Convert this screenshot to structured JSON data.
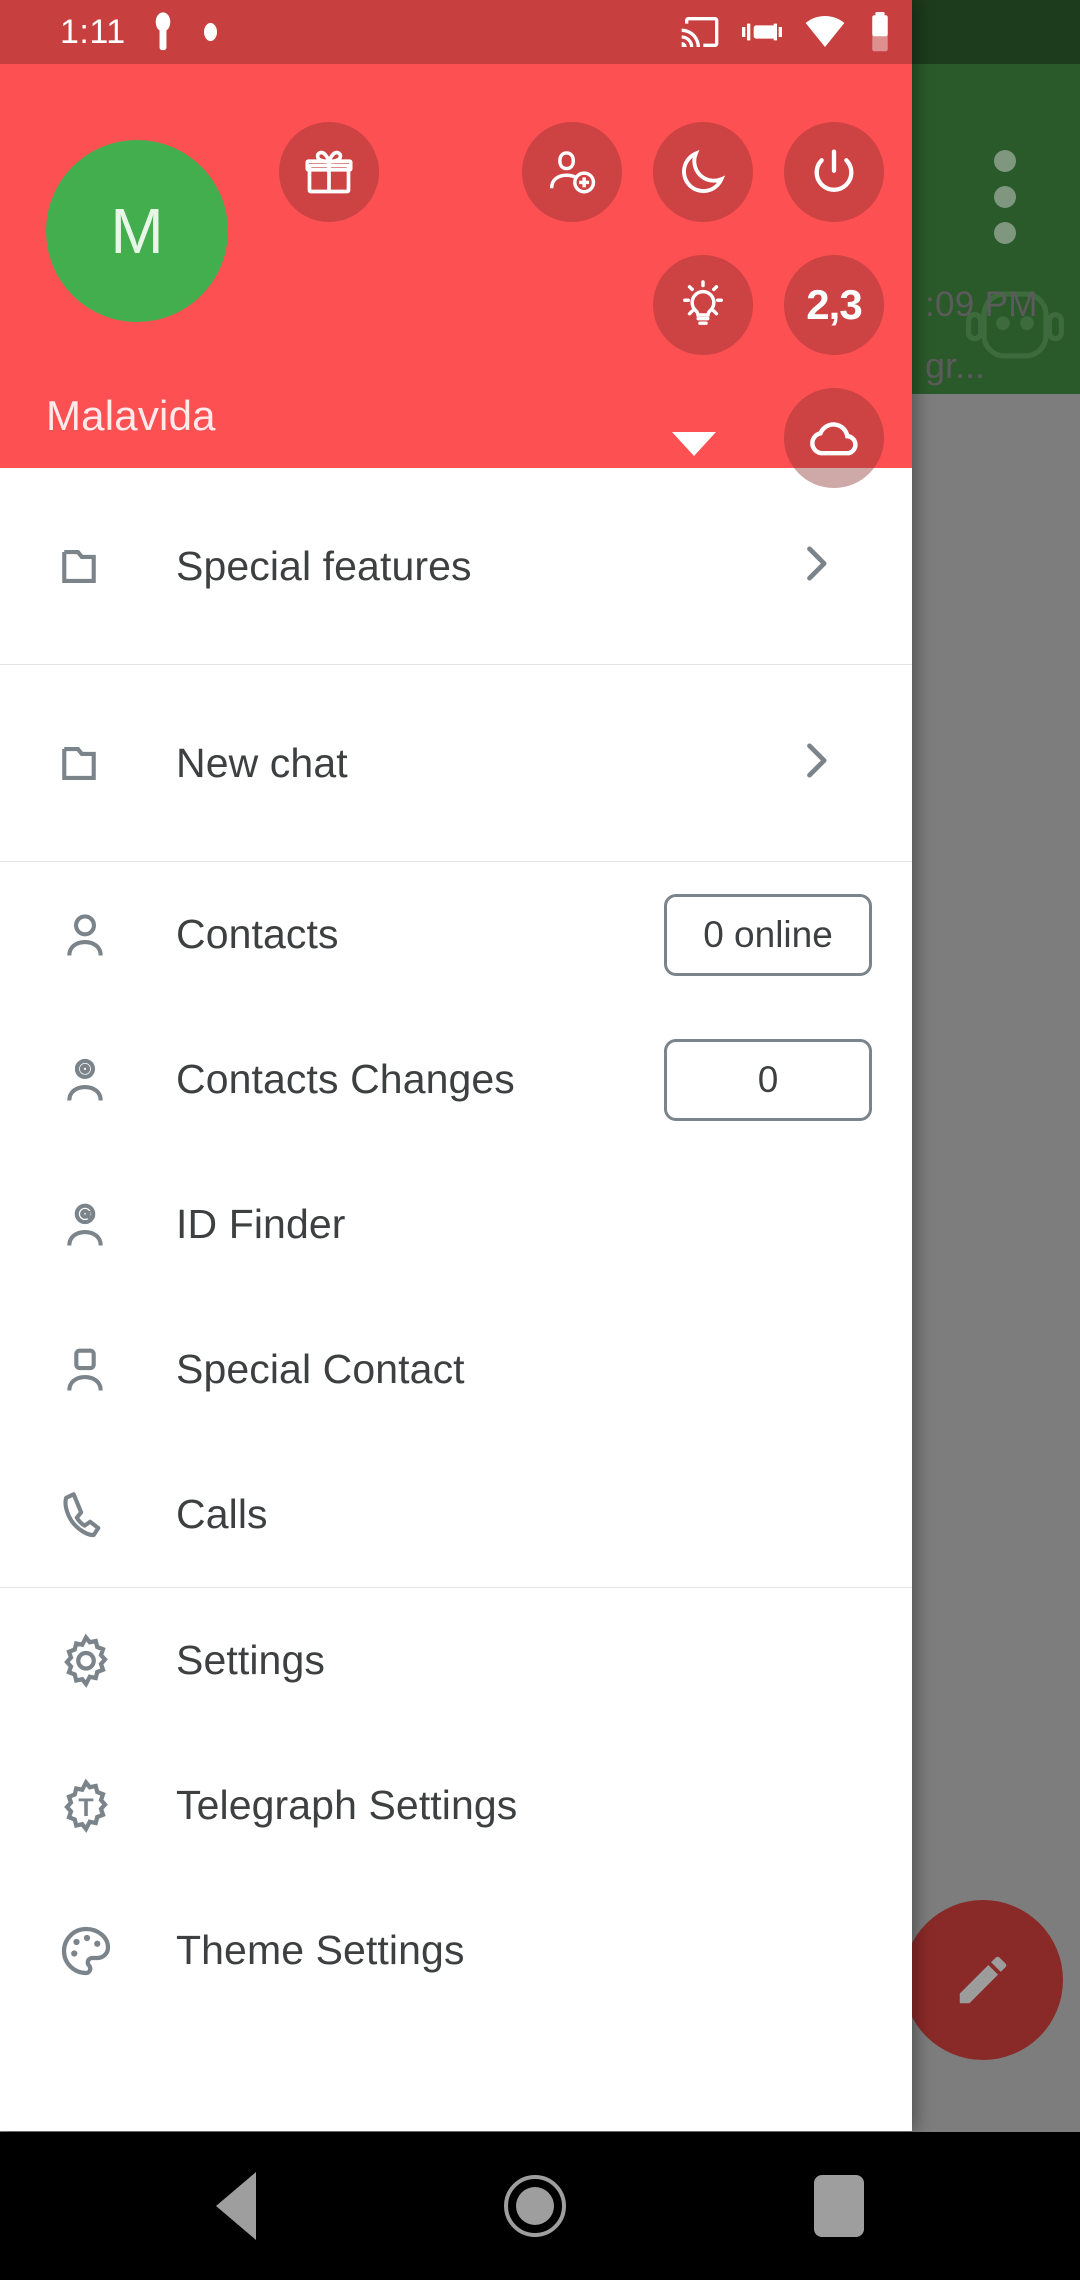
{
  "status_bar": {
    "time": "1:11",
    "icons": [
      "key-icon",
      "dot-indicator",
      "cast-icon",
      "vibrate-icon",
      "wifi-icon",
      "battery-icon"
    ]
  },
  "background": {
    "app_bar_color": "#2a5a2a",
    "overflow_menu": "overflow-menu-icon",
    "bot_icon": "robot-icon",
    "message_time": ":09 PM",
    "message_snippet": "gr...",
    "fab": {
      "name": "compose-fab",
      "icon": "pencil-icon",
      "color": "#8a2a28"
    }
  },
  "drawer": {
    "accent_color": "#fc5052",
    "profile": {
      "avatar_initial": "M",
      "avatar_color": "#43ae4e",
      "name": "Malavida",
      "expand_caret": "chevron-down-icon"
    },
    "header_actions": [
      {
        "id": "gift",
        "icon": "gift-icon",
        "label": ""
      },
      {
        "id": "adduser",
        "icon": "add-contact-icon",
        "label": ""
      },
      {
        "id": "moon",
        "icon": "moon-icon",
        "label": ""
      },
      {
        "id": "power",
        "icon": "power-icon",
        "label": ""
      },
      {
        "id": "bulb",
        "icon": "lightbulb-icon",
        "label": ""
      },
      {
        "id": "count",
        "icon": "text-badge",
        "label": "2,3"
      },
      {
        "id": "cloud",
        "icon": "cloud-icon",
        "label": ""
      }
    ],
    "sections": [
      {
        "items": [
          {
            "icon": "folder-icon",
            "label": "Special features",
            "accessory": "chevron-right-icon"
          }
        ]
      },
      {
        "items": [
          {
            "icon": "folder-icon",
            "label": "New chat",
            "accessory": "chevron-right-icon"
          }
        ]
      },
      {
        "items": [
          {
            "icon": "person-icon",
            "label": "Contacts",
            "badge": "0 online"
          },
          {
            "icon": "person-changes-icon",
            "label": "Contacts Changes",
            "badge": "0"
          },
          {
            "icon": "person-at-icon",
            "label": "ID Finder"
          },
          {
            "icon": "person-square-icon",
            "label": "Special Contact"
          },
          {
            "icon": "phone-icon",
            "label": "Calls"
          }
        ]
      },
      {
        "items": [
          {
            "icon": "gear-icon",
            "label": "Settings"
          },
          {
            "icon": "gear-t-icon",
            "label": "Telegraph Settings"
          },
          {
            "icon": "palette-icon",
            "label": "Theme Settings"
          }
        ]
      }
    ]
  },
  "nav_bar": {
    "back": "back-triangle-icon",
    "home": "home-circle-icon",
    "recents": "recents-square-icon"
  }
}
